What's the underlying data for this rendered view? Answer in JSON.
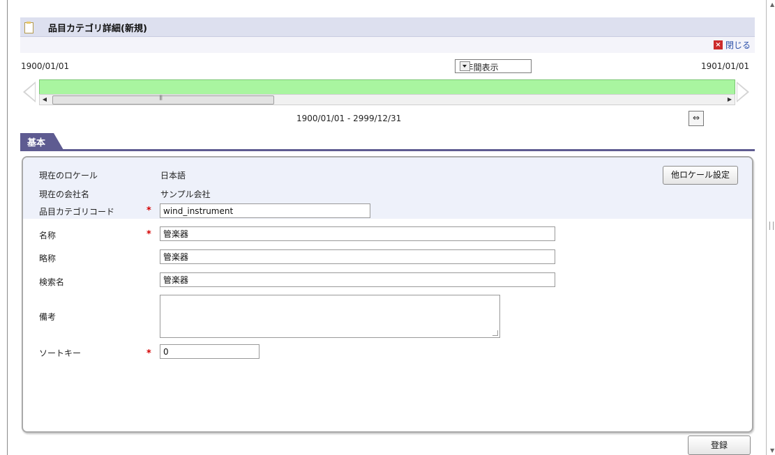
{
  "title": "品目カテゴリ詳細(新規)",
  "close_label": "閉じる",
  "timeline": {
    "start_date": "1900/01/01",
    "end_date": "1901/01/01",
    "display_mode": "1年間表示",
    "range_text": "1900/01/01 - 2999/12/31"
  },
  "tabs": [
    {
      "label": "基本"
    }
  ],
  "form": {
    "locale_label": "現在のロケール",
    "locale_value": "日本語",
    "company_label": "現在の会社名",
    "company_value": "サンプル会社",
    "code_label": "品目カテゴリコード",
    "code_value": "wind_instrument",
    "name_label": "名称",
    "name_value": "管楽器",
    "short_label": "略称",
    "short_value": "管楽器",
    "search_label": "検索名",
    "search_value": "管楽器",
    "note_label": "備考",
    "note_value": "",
    "sort_label": "ソートキー",
    "sort_value": "0",
    "required_mark": "*"
  },
  "buttons": {
    "other_locale": "他ロケール設定",
    "register": "登録"
  },
  "colors": {
    "tab": "#5e5b91",
    "timeline": "#a9f5a0",
    "required": "#d40000",
    "titlebar": "#dde0ef"
  }
}
